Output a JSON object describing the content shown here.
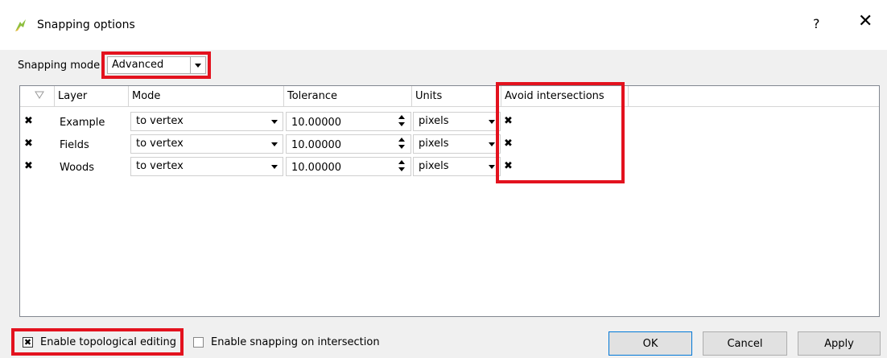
{
  "window": {
    "title": "Snapping options",
    "help": "?",
    "close": "✕"
  },
  "snapping_mode": {
    "label": "Snapping mode",
    "value": "Advanced"
  },
  "table": {
    "headers": {
      "layer": "Layer",
      "mode": "Mode",
      "tolerance": "Tolerance",
      "units": "Units",
      "avoid": "Avoid intersections"
    },
    "rows": [
      {
        "enabled": "✖",
        "layer": "Example",
        "mode": "to vertex",
        "tolerance": "10.00000",
        "units": "pixels",
        "avoid": "✖"
      },
      {
        "enabled": "✖",
        "layer": "Fields",
        "mode": "to vertex",
        "tolerance": "10.00000",
        "units": "pixels",
        "avoid": "✖"
      },
      {
        "enabled": "✖",
        "layer": "Woods",
        "mode": "to vertex",
        "tolerance": "10.00000",
        "units": "pixels",
        "avoid": "✖"
      }
    ]
  },
  "options": {
    "topological": {
      "label": "Enable topological editing",
      "checked": "✖"
    },
    "intersection": {
      "label": "Enable snapping on intersection"
    }
  },
  "buttons": {
    "ok": "OK",
    "cancel": "Cancel",
    "apply": "Apply"
  },
  "colors": {
    "highlight": "#e3121e",
    "titlebar": "#ffffff",
    "dialog_bg": "#f0f0f0"
  }
}
